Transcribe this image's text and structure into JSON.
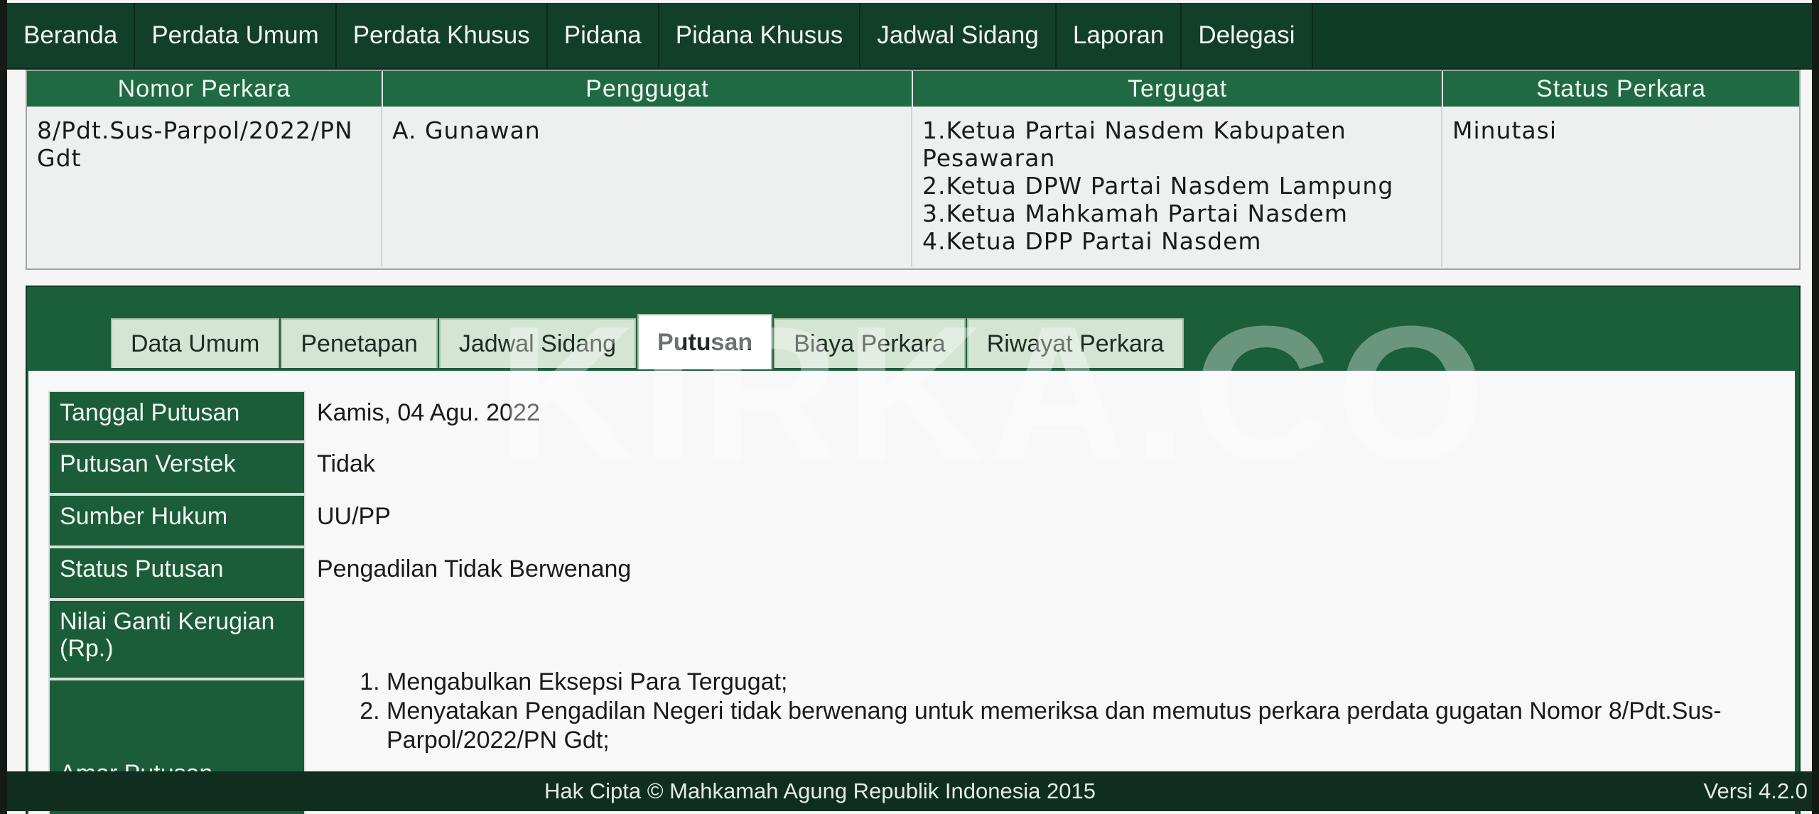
{
  "nav": [
    "Beranda",
    "Perdata Umum",
    "Perdata Khusus",
    "Pidana",
    "Pidana Khusus",
    "Jadwal Sidang",
    "Laporan",
    "Delegasi"
  ],
  "case_table": {
    "headers": [
      "Nomor Perkara",
      "Penggugat",
      "Tergugat",
      "Status Perkara"
    ],
    "nomor": "8/Pdt.Sus-Parpol/2022/PN Gdt",
    "penggugat": "A. Gunawan",
    "tergugat": [
      "1.Ketua Partai Nasdem Kabupaten Pesawaran",
      "2.Ketua DPW Partai Nasdem Lampung",
      "3.Ketua Mahkamah Partai Nasdem",
      "4.Ketua DPP Partai Nasdem"
    ],
    "status": "Minutasi"
  },
  "tabs": [
    "Data Umum",
    "Penetapan",
    "Jadwal Sidang",
    "Putusan",
    "Biaya Perkara",
    "Riwayat Perkara"
  ],
  "active_tab": "Putusan",
  "details": {
    "tanggal_label": "Tanggal Putusan",
    "tanggal_value": "Kamis, 04 Agu. 2022",
    "verstek_label": "Putusan Verstek",
    "verstek_value": "Tidak",
    "sumber_label": "Sumber Hukum",
    "sumber_value": "UU/PP",
    "status_label": "Status Putusan",
    "status_value": "Pengadilan Tidak Berwenang",
    "nilai_label": "Nilai Ganti Kerugian (Rp.)",
    "nilai_value": "",
    "amar_label": "Amar Putusan",
    "amar_items": [
      "Mengabulkan Eksepsi Para Tergugat;",
      "Menyatakan Pengadilan Negeri tidak berwenang untuk memeriksa dan memutus perkara perdata gugatan Nomor 8/Pdt.Sus-Parpol/2022/PN Gdt;"
    ]
  },
  "watermark": "KIRKA.CO",
  "footer": {
    "copyright": "Hak Cipta © Mahkamah Agung Republik Indonesia 2015",
    "version": "Versi 4.2.0"
  }
}
